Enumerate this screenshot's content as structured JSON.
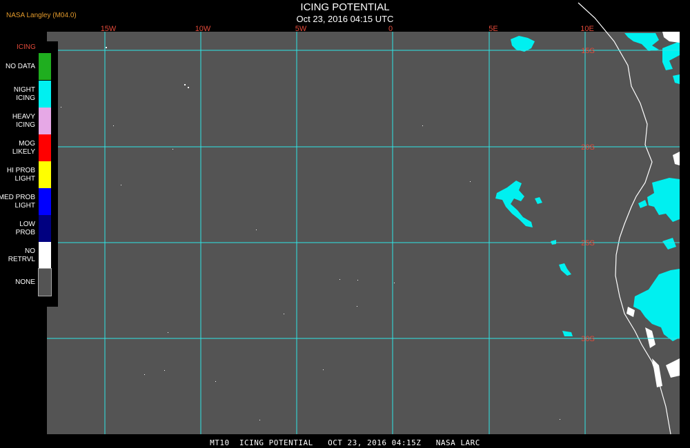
{
  "header": {
    "agency": "NASA Langley (M04.0)",
    "title": "ICING POTENTIAL",
    "subtitle": "Oct 23, 2016 04:15 UTC"
  },
  "map": {
    "background_color": "#545454",
    "grid_color": "#2ee6e6",
    "coast_color": "#ffffff",
    "lon_labels": [
      "15W",
      "10W",
      "5W",
      "0",
      "5E",
      "10E"
    ],
    "lat_labels": [
      "15S",
      "20S",
      "25S",
      "30S"
    ]
  },
  "legend": {
    "title": "ICING",
    "items": [
      {
        "label": "NO DATA",
        "color": "#1fae1f"
      },
      {
        "label": "NIGHT\nICING",
        "color": "#00f0f0"
      },
      {
        "label": "HEAVY\nICING",
        "color": "#e6a8e6"
      },
      {
        "label": "MOG\nLIKELY",
        "color": "#ff0000"
      },
      {
        "label": "HI PROB\nLIGHT",
        "color": "#ffff00"
      },
      {
        "label": "MED PROB\nLIGHT",
        "color": "#0000ff"
      },
      {
        "label": "LOW\nPROB",
        "color": "#000080"
      },
      {
        "label": "NO\nRETRVL",
        "color": "#ffffff"
      },
      {
        "label": "NONE",
        "color": "#545454"
      }
    ]
  },
  "footer": {
    "text": "MT10  ICING POTENTIAL   OCT 23, 2016 04:15Z   NASA LARC"
  }
}
